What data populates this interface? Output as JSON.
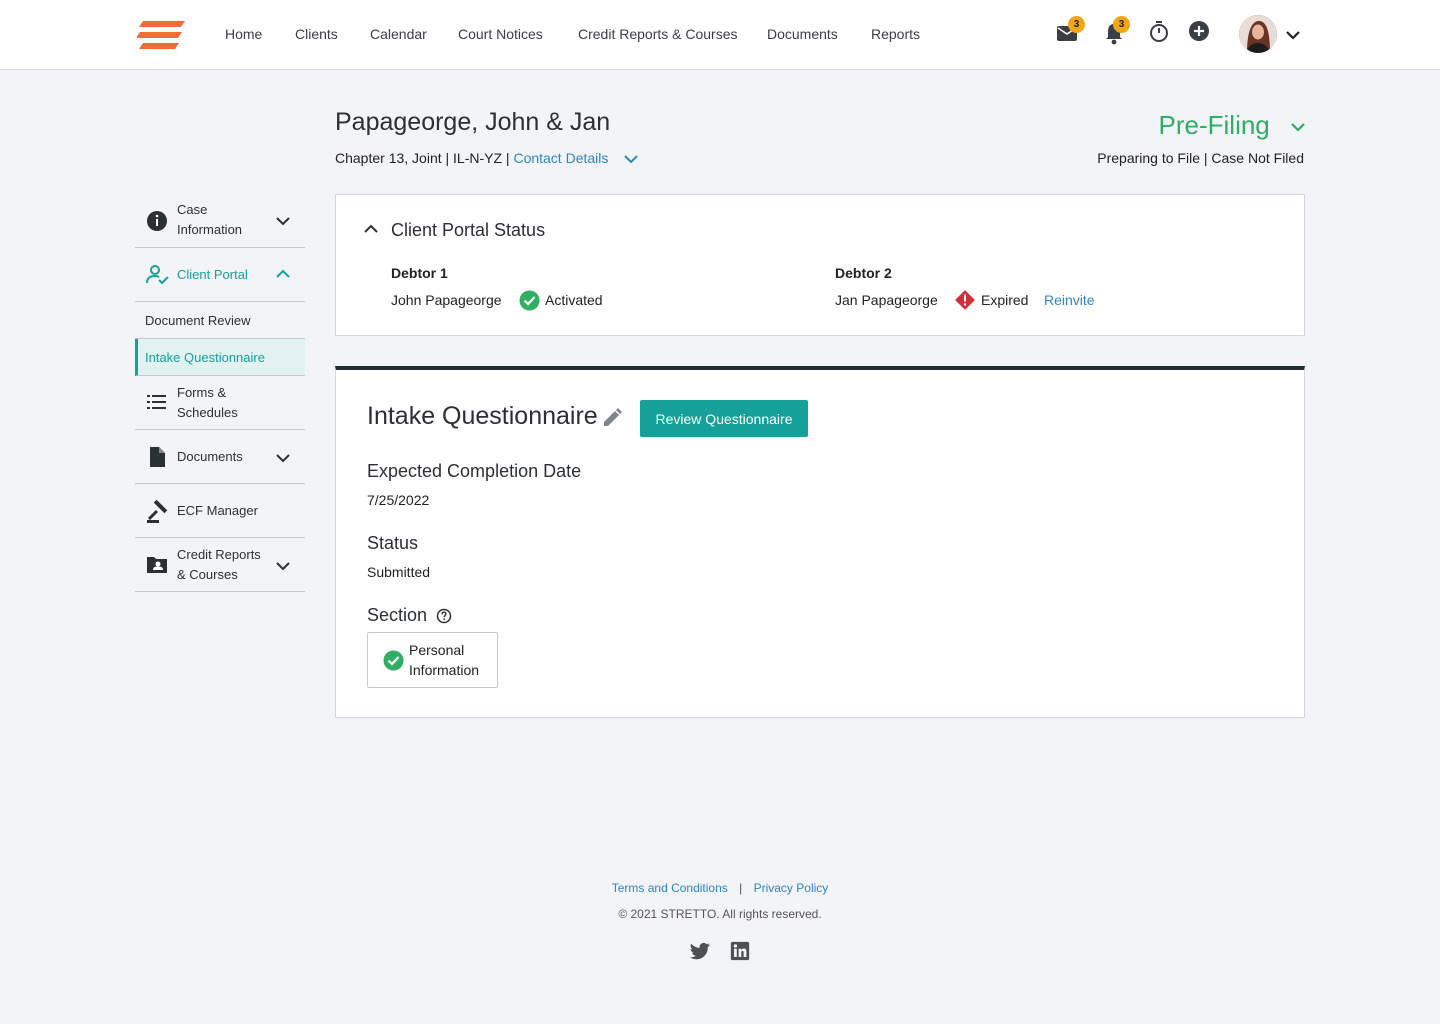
{
  "nav": {
    "links": [
      "Home",
      "Clients",
      "Calendar",
      "Court Notices",
      "Credit Reports & Courses",
      "Documents",
      "Reports"
    ],
    "mail_badge": "3",
    "notif_badge": "3",
    "icons": [
      "mail-icon",
      "bell-icon",
      "timer-icon",
      "add-circle-icon",
      "chevron-down-icon"
    ]
  },
  "case": {
    "title": "Papageorge, John & Jan",
    "subtitle": "Chapter 13, Joint | IL-N-YZ |",
    "contact_link": "Contact Details",
    "stage": "Pre-Filing",
    "stage_sub": "Preparing to File | Case Not Filed"
  },
  "sidebar": {
    "case_info": "Case Information",
    "client_portal": "Client Portal",
    "document_review": "Document Review",
    "intake_questionnaire": "Intake Questionnaire",
    "forms_schedules": "Forms & Schedules",
    "documents": "Documents",
    "ecf_manager": "ECF Manager",
    "credit_reports": "Credit Reports & Courses"
  },
  "portal": {
    "title": "Client Portal Status",
    "debtor1_label": "Debtor 1",
    "debtor1_name": "John Papageorge",
    "debtor1_status": "Activated",
    "debtor2_label": "Debtor 2",
    "debtor2_name": "Jan Papageorge",
    "debtor2_status": "Expired",
    "reinvite": "Reinvite"
  },
  "questionnaire": {
    "title": "Intake Questionnaire",
    "review_button": "Review Questionnaire",
    "completion_label": "Expected Completion Date",
    "completion_value": "7/25/2022",
    "status_label": "Status",
    "status_value": "Submitted",
    "section_label": "Section",
    "section_chip": "Personal Information"
  },
  "footer": {
    "terms": "Terms and Conditions",
    "separator": "|",
    "privacy": "Privacy Policy",
    "copyright": "© 2021 STRETTO. All rights reserved."
  },
  "colors": {
    "teal": "#16a09a",
    "green": "#2fae64",
    "link": "#2e86c1",
    "badge": "#f2a516",
    "error": "#d62d3a"
  }
}
